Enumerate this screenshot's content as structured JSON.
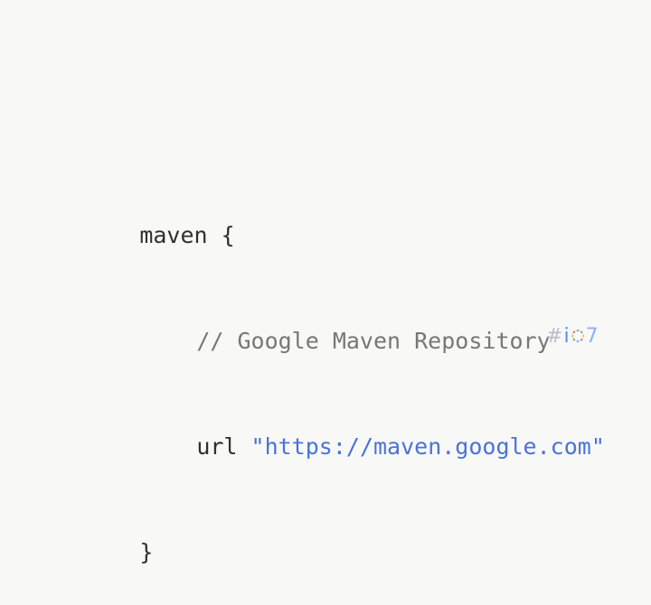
{
  "code": {
    "line1": "maven {",
    "line2": "// Google Maven Repository",
    "line3_keyword": "url",
    "line3_string": "\"https://maven.google.com\"",
    "line4": "}"
  },
  "badge": {
    "hash": "#",
    "i": "i",
    "seven": "7"
  },
  "colors": {
    "text": "#2f2f2f",
    "comment": "#777777",
    "string": "#4a73d8",
    "badge_blue": "#4f8cf7",
    "badge_gray": "#b6bec9"
  },
  "icons": {
    "badge_o": "circle-dotted-icon"
  }
}
